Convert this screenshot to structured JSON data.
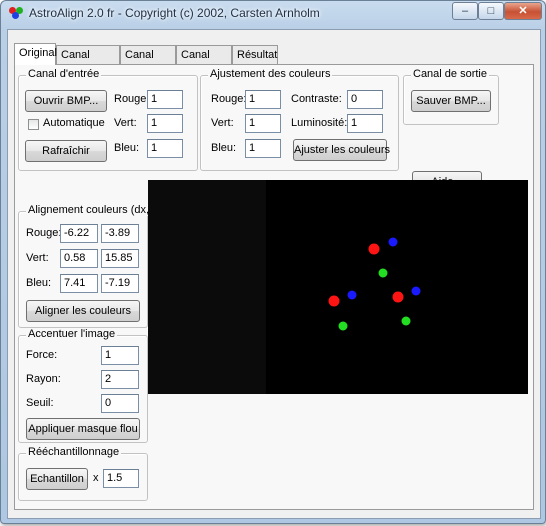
{
  "window": {
    "title": "AstroAlign 2.0 fr - Copyright (c) 2002, Carsten Arnholm"
  },
  "title_buttons": {
    "minimize": "–",
    "maximize": "□",
    "close": "✕"
  },
  "tabs": [
    "Original",
    "Canal rouge",
    "Canal vert",
    "Canal bleu",
    "Résultat"
  ],
  "canal_entree": {
    "title": "Canal d'entrée",
    "open_button": "Ouvrir BMP...",
    "auto_label": "Automatique",
    "refresh_button": "Rafraîchir",
    "rouge_label": "Rouge:",
    "rouge_value": "1",
    "vert_label": "Vert:",
    "vert_value": "1",
    "bleu_label": "Bleu:",
    "bleu_value": "1"
  },
  "ajustement": {
    "title": "Ajustement des couleurs",
    "rouge_label": "Rouge:",
    "rouge_value": "1",
    "vert_label": "Vert:",
    "vert_value": "1",
    "bleu_label": "Bleu:",
    "bleu_value": "1",
    "contraste_label": "Contraste:",
    "contraste_value": "0",
    "luminosite_label": "Luminosité:",
    "luminosite_value": "1",
    "apply_button": "Ajuster les couleurs"
  },
  "canal_sortie": {
    "title": "Canal de sortie",
    "save_button": "Sauver BMP..."
  },
  "aide_button": "Aide...",
  "alignement": {
    "title": "Alignement couleurs (dx,dy)",
    "rouge_label": "Rouge:",
    "rouge_dx": "-6.22",
    "rouge_dy": "-3.89",
    "vert_label": "Vert:",
    "vert_dx": "0.58",
    "vert_dy": "15.85",
    "bleu_label": "Bleu:",
    "bleu_dx": "7.41",
    "bleu_dy": "-7.19",
    "align_button": "Aligner les couleurs"
  },
  "accentuer": {
    "title": "Accentuer l'image",
    "force_label": "Force:",
    "force_value": "1",
    "rayon_label": "Rayon:",
    "rayon_value": "2",
    "seuil_label": "Seuil:",
    "seuil_value": "0",
    "apply_button": "Appliquer masque flou"
  },
  "reechantillonnage": {
    "title": "Rééchantillonnage",
    "sample_button": "Echantillon",
    "x_label": "x",
    "factor_value": "1.5"
  },
  "colors": {
    "red": "#ff1414",
    "green": "#22dd22",
    "blue": "#1a1aff",
    "icon_red": "#e02020",
    "icon_green": "#20b020",
    "icon_blue": "#2040e0"
  }
}
